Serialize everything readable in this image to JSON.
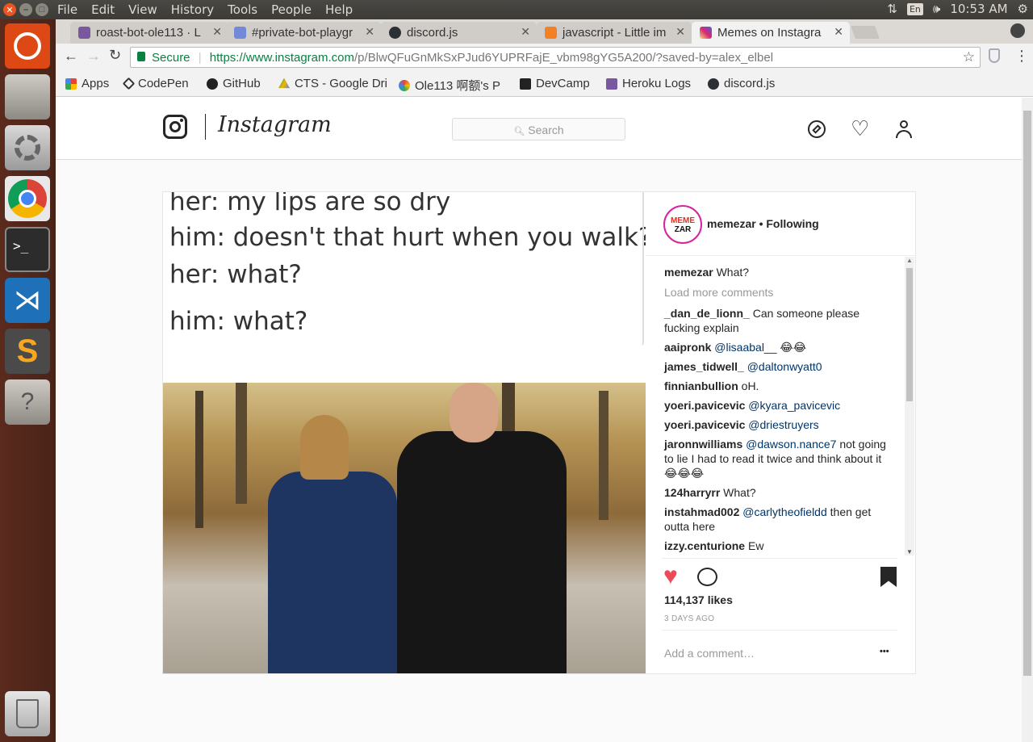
{
  "os": {
    "menus": [
      "File",
      "Edit",
      "View",
      "History",
      "Tools",
      "People",
      "Help"
    ],
    "lang": "En",
    "clock": "10:53 AM"
  },
  "tabs": [
    {
      "title": "roast-bot-ole113 · L"
    },
    {
      "title": "#private-bot-playgr"
    },
    {
      "title": "discord.js"
    },
    {
      "title": "javascript - Little im"
    },
    {
      "title": "Memes on Instagra"
    }
  ],
  "omnibox": {
    "secure": "Secure",
    "url_host": "https://www.instagram.com",
    "url_path": "/p/BlwQFuGnMkSxPJud6YUPRFajE_vbm98gYG5A200/?saved-by=alex_elbel"
  },
  "bookmarks": [
    "Apps",
    "CodePen",
    "GitHub",
    "CTS - Google Dri",
    "Ole113 啊额's P",
    "DevCamp",
    "Heroku Logs",
    "discord.js"
  ],
  "instagram": {
    "wordmark": "Instagram",
    "search_placeholder": "Search",
    "post": {
      "captions": [
        "her: my lips are so dry",
        "him: doesn't that hurt when you walk?",
        "her: what?",
        "him: what?"
      ],
      "username": "memezar",
      "follow_state": "• Following",
      "avatar_text": [
        "MEME",
        "ZAR"
      ],
      "comments": [
        {
          "user": "memezar",
          "tag": "",
          "text": " What?"
        },
        {
          "user": "_dan_de_lionn_",
          "tag": "",
          "text": " Can someone please fucking explain"
        },
        {
          "user": "aaipronk",
          "tag": " @lisaabal__",
          "text": " 😂😂"
        },
        {
          "user": "james_tidwell_",
          "tag": " @daltonwyatt0",
          "text": ""
        },
        {
          "user": "finnianbullion",
          "tag": "",
          "text": " oH."
        },
        {
          "user": "yoeri.pavicevic",
          "tag": " @kyara_pavicevic",
          "text": ""
        },
        {
          "user": "yoeri.pavicevic",
          "tag": " @driestruyers",
          "text": ""
        },
        {
          "user": "jaronnwilliams",
          "tag": " @dawson.nance7",
          "text": " not going to lie I had to read it twice and think about it 😂😂😂"
        },
        {
          "user": "124harryrr",
          "tag": "",
          "text": " What?"
        },
        {
          "user": "instahmad002",
          "tag": " @carlytheofieldd",
          "text": " then get outta here"
        },
        {
          "user": "izzy.centurione",
          "tag": "",
          "text": " Ew"
        }
      ],
      "load_more": "Load more comments",
      "likes": "114,137 likes",
      "timestamp": "3 DAYS AGO",
      "add_comment_placeholder": "Add a comment…",
      "more": "•••"
    }
  },
  "colors": {
    "like": "#ed4956",
    "link": "#003569",
    "ubuntu_bar": "#3c3b37"
  }
}
